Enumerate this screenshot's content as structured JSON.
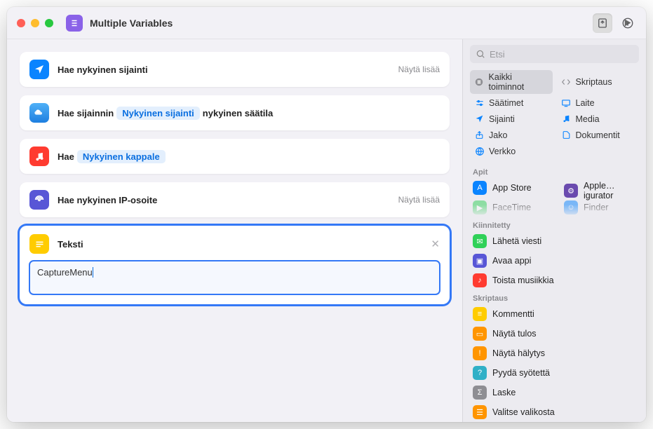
{
  "title": "Multiple Variables",
  "search_placeholder": "Etsi",
  "show_more_label": "Näytä lisää",
  "actions": {
    "location": {
      "label": "Hae nykyinen sijainti"
    },
    "weather": {
      "prefix": "Hae sijainnin",
      "token": "Nykyinen sijainti",
      "suffix": "nykyinen säätila"
    },
    "music": {
      "prefix": "Hae",
      "token": "Nykyinen kappale"
    },
    "ip": {
      "label": "Hae nykyinen IP-osoite"
    },
    "text": {
      "label": "Teksti",
      "value": "CaptureMenu"
    }
  },
  "categories": {
    "all": "Kaikki toiminnot",
    "controls": "Säätimet",
    "location": "Sijainti",
    "sharing": "Jako",
    "web": "Verkko",
    "scripting": "Skriptaus",
    "device": "Laite",
    "media": "Media",
    "documents": "Dokumentit"
  },
  "sections": {
    "apps": "Apit",
    "pinned": "Kiinnitetty",
    "scripting": "Skriptaus"
  },
  "apps": {
    "appstore": "App Store",
    "configurator": "Apple…igurator",
    "facetime": "FaceTime",
    "finder": "Finder"
  },
  "pinned": {
    "message": "Lähetä viesti",
    "openapp": "Avaa appi",
    "playmusic": "Toista musiikkia"
  },
  "scripting_items": {
    "comment": "Kommentti",
    "showresult": "Näytä tulos",
    "showalert": "Näytä hälytys",
    "askinput": "Pyydä syötettä",
    "calculate": "Laske",
    "choosemenu": "Valitse valikosta"
  }
}
